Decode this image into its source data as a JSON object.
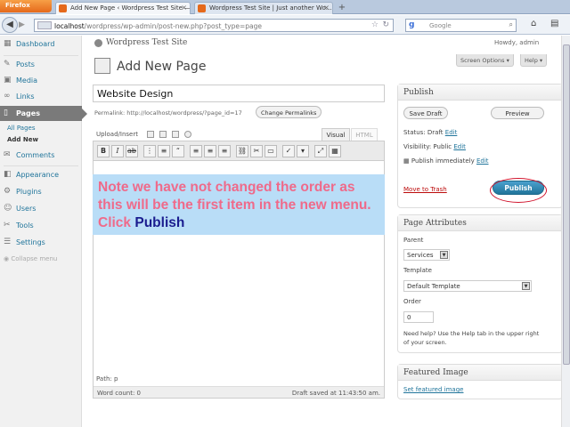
{
  "browser": {
    "firefox_label": "Firefox",
    "tabs": [
      {
        "label": "Add New Page ‹ Wordpress Test Site —"
      },
      {
        "label": "Wordpress Test Site | Just another Wo…"
      }
    ],
    "new_tab": "+",
    "back_icon": "back-arrow-icon",
    "url_host": "localhost",
    "url_path": "/wordpress/wp-admin/post-new.php?post_type=page",
    "search_placeholder": "Google",
    "search_logo": "g"
  },
  "admin_menu": {
    "items": [
      {
        "label": "Dashboard",
        "icon": "dashboard-icon"
      },
      {
        "label": "Posts",
        "icon": "posts-icon"
      },
      {
        "label": "Media",
        "icon": "media-icon"
      },
      {
        "label": "Links",
        "icon": "links-icon"
      },
      {
        "label": "Pages",
        "icon": "pages-icon"
      },
      {
        "label": "Comments",
        "icon": "comments-icon"
      },
      {
        "label": "Appearance",
        "icon": "appearance-icon"
      },
      {
        "label": "Plugins",
        "icon": "plugins-icon"
      },
      {
        "label": "Users",
        "icon": "users-icon"
      },
      {
        "label": "Tools",
        "icon": "tools-icon"
      },
      {
        "label": "Settings",
        "icon": "settings-icon"
      }
    ],
    "pages_sub": [
      "All Pages",
      "Add New"
    ],
    "collapse": "Collapse menu"
  },
  "header": {
    "site_title": "Wordpress Test Site",
    "howdy": "Howdy, admin",
    "page_title": "Add New Page",
    "screen_options": "Screen Options",
    "help": "Help"
  },
  "editor": {
    "title_value": "Website Design",
    "permalink": "Permalink: http://localhost/wordpress/?page_id=17",
    "change_permalinks": "Change Permalinks",
    "upload_insert": "Upload/Insert",
    "tab_visual": "Visual",
    "tab_html": "HTML",
    "path": "Path: p",
    "word_count": "Word count: 0",
    "draft_saved": "Draft saved at 11:43:50 am."
  },
  "annotation": {
    "text": "Note we have not changed the order as this will be the first item in the new menu. Click ",
    "highlight": "Publish"
  },
  "publish_box": {
    "title": "Publish",
    "save_draft": "Save Draft",
    "preview": "Preview",
    "status_label": "Status: Draft",
    "status_edit": "Edit",
    "visibility_label": "Visibility: Public",
    "visibility_edit": "Edit",
    "publish_label": "Publish immediately",
    "publish_edit": "Edit",
    "move_trash": "Move to Trash",
    "publish_button": "Publish"
  },
  "attributes_box": {
    "title": "Page Attributes",
    "parent_label": "Parent",
    "parent_value": "Services",
    "template_label": "Template",
    "template_value": "Default Template",
    "order_label": "Order",
    "order_value": "0",
    "help_text_1": "Need help? Use the Help tab in the upper right",
    "help_text_2": "of your screen."
  },
  "featured_box": {
    "title": "Featured Image",
    "link": "Set featured image"
  },
  "colors": {
    "annotation_bg": "#b9ddf7",
    "annotation_text": "#ef6a8a",
    "annotation_highlight": "#1a1c8f",
    "publish_button": "#21759b",
    "circle": "#d0122b"
  }
}
